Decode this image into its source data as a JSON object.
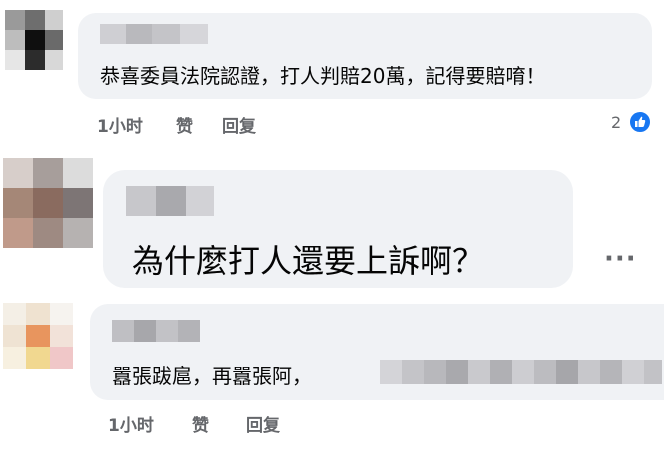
{
  "comments": [
    {
      "text": "恭喜委員法院認證，打人判賠20萬，記得要賠唷！",
      "time": "1小时",
      "like_label": "赞",
      "reply_label": "回复",
      "reaction_count": "2"
    },
    {
      "text": "為什麼打人還要上訴啊？",
      "more": "···"
    },
    {
      "text": "囂張跋扈，再囂張阿，",
      "time": "1小时",
      "like_label": "赞",
      "reply_label": "回复"
    }
  ],
  "colors": {
    "bubble": "#f0f2f5",
    "meta": "#65676b",
    "like_blue": "#1877f2"
  },
  "icons": [
    "like-thumbs-up-icon",
    "more-options-icon"
  ]
}
